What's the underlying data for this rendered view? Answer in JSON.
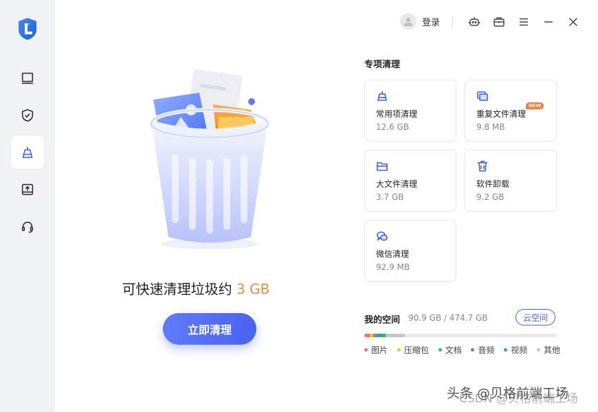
{
  "sidebar": {
    "logo": "app-logo",
    "items": [
      {
        "icon": "monitor-icon",
        "active": false
      },
      {
        "icon": "shield-check-icon",
        "active": false
      },
      {
        "icon": "broom-clean-icon",
        "active": true
      },
      {
        "icon": "drive-upload-icon",
        "active": false
      },
      {
        "icon": "headset-icon",
        "active": false
      }
    ]
  },
  "topbar": {
    "login_label": "登录",
    "icons": [
      "robot-icon",
      "toolbox-icon",
      "menu-icon",
      "minimize-icon",
      "close-icon"
    ]
  },
  "hero": {
    "title_prefix": "可快速清理垃圾约",
    "amount": "3 GB",
    "button_label": "立即清理"
  },
  "special_clean": {
    "title": "专项清理",
    "cards": [
      {
        "name": "常用项清理",
        "size": "12.6 GB",
        "icon": "broom-icon",
        "badge": ""
      },
      {
        "name": "重复文件清理",
        "size": "9.8 MB",
        "icon": "duplicate-files-icon",
        "badge": "NEW"
      },
      {
        "name": "大文件清理",
        "size": "3.7 GB",
        "icon": "folder-icon",
        "badge": ""
      },
      {
        "name": "软件卸载",
        "size": "9.2 GB",
        "icon": "trash-icon",
        "badge": ""
      },
      {
        "name": "微信清理",
        "size": "92.9 MB",
        "icon": "wechat-icon",
        "badge": ""
      }
    ]
  },
  "storage": {
    "title": "我的空间",
    "value": "90.9 GB / 474.7 GB",
    "cloud_button": "云空间",
    "used_fraction": 0.1915,
    "legend": [
      {
        "label": "图片",
        "color": "#f06b8a",
        "share": 0.03
      },
      {
        "label": "压缩包",
        "color": "#f5c518",
        "share": 0.015
      },
      {
        "label": "文档",
        "color": "#2ea8e0",
        "share": 0.02
      },
      {
        "label": "音频",
        "color": "#9b59d6",
        "share": 0.015
      },
      {
        "label": "视频",
        "color": "#2fb36a",
        "share": 0.03
      },
      {
        "label": "其他",
        "color": "#c4c6cc",
        "share": 0.1
      }
    ]
  },
  "watermark": {
    "text": "头条 @贝格前端工场",
    "text2": "CSDN @贝格前端工场"
  }
}
